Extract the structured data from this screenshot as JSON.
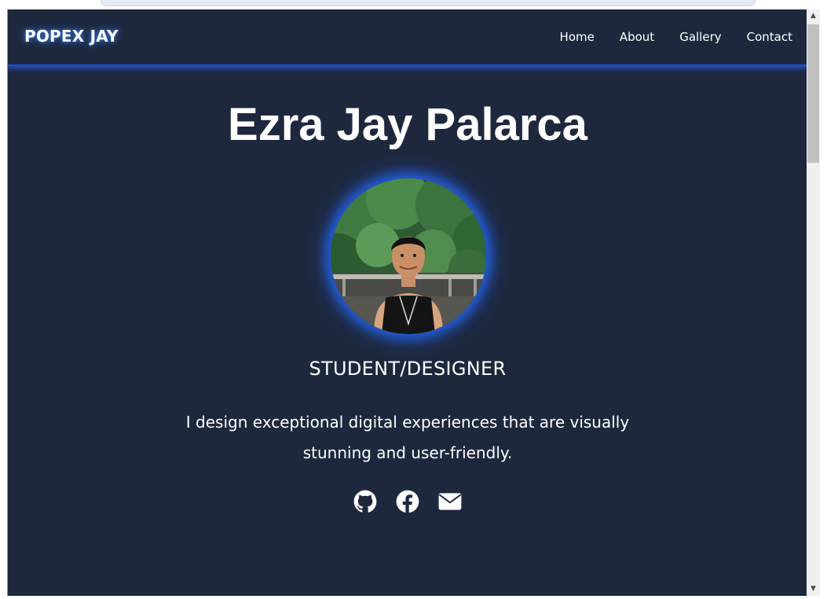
{
  "navbar": {
    "brand": "POPEX JAY",
    "links": [
      "Home",
      "About",
      "Gallery",
      "Contact"
    ]
  },
  "hero": {
    "name": "Ezra Jay Palarca",
    "role": "STUDENT/DESIGNER",
    "bio": "I design exceptional digital experiences that are visually stunning and user-friendly."
  },
  "socials": [
    {
      "icon": "github-icon"
    },
    {
      "icon": "facebook-icon"
    },
    {
      "icon": "envelope-icon"
    }
  ],
  "colors": {
    "background": "#1e283d",
    "accent_glow": "#2563eb",
    "text": "#ffffff"
  }
}
